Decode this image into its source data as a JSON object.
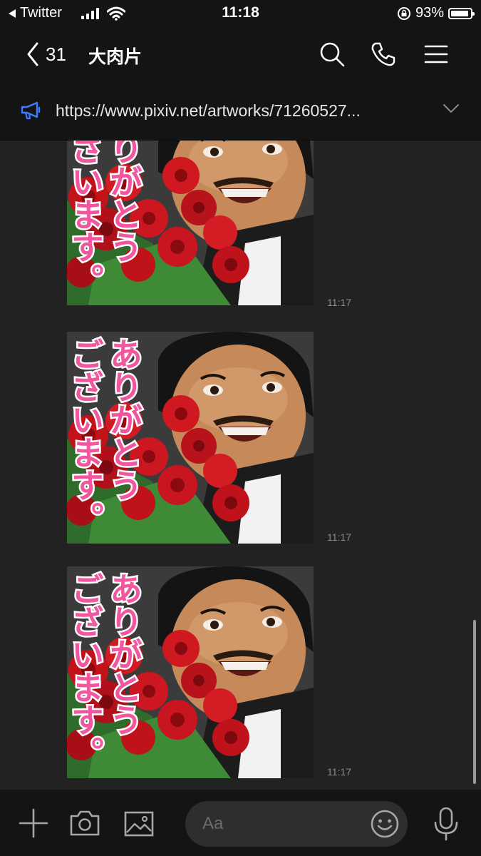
{
  "status_bar": {
    "back_app": "Twitter",
    "time": "11:18",
    "battery": "93%",
    "battery_level": 0.93,
    "signal_bars": 4
  },
  "header": {
    "unread_count": "31",
    "title": "大肉片",
    "icons": [
      "search-icon",
      "phone-icon",
      "menu-icon"
    ]
  },
  "announcement": {
    "icon": "megaphone-icon",
    "text": "https://www.pixiv.net/artworks/71260527..."
  },
  "messages": [
    {
      "type": "sticker",
      "text_line1": "ありがとう",
      "text_line2": "ございます。",
      "time": "11:17"
    },
    {
      "type": "sticker",
      "text_line1": "ありがとう",
      "text_line2": "ございます。",
      "time": "11:17"
    },
    {
      "type": "sticker",
      "text_line1": "ありがとう",
      "text_line2": "ございます。",
      "time": "11:17"
    }
  ],
  "composer": {
    "placeholder": "Aa",
    "icons": [
      "plus-icon",
      "camera-icon",
      "image-icon",
      "emoji-icon",
      "microphone-icon"
    ]
  },
  "colors": {
    "background": "#222222",
    "bar": "#141414",
    "accent_blue": "#3f7bff",
    "sticker_text": "#f0579e"
  }
}
